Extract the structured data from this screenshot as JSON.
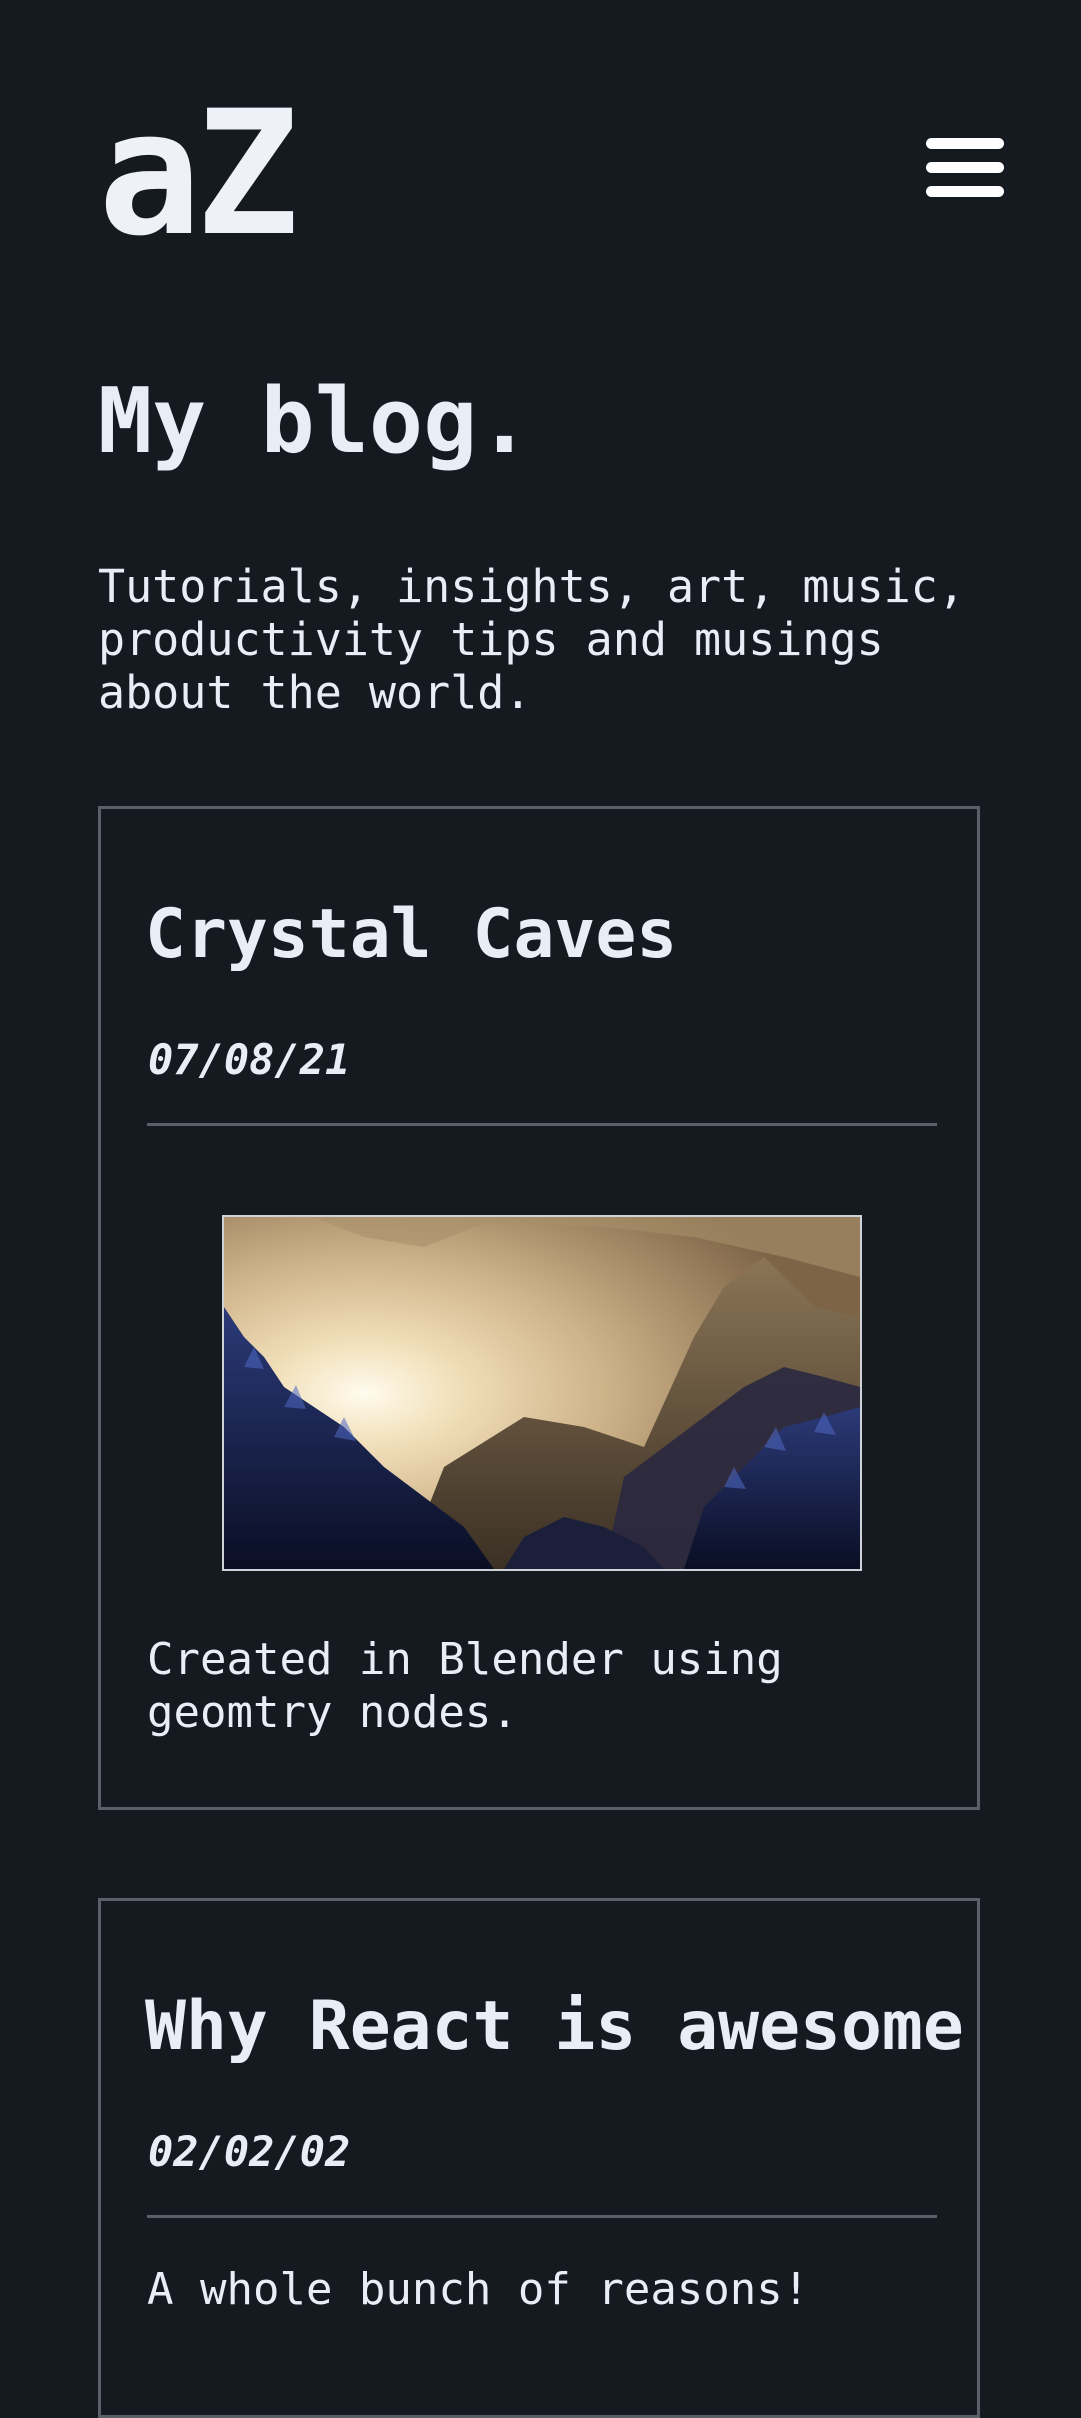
{
  "header": {
    "logo_text": "aZ",
    "menu_icon": "hamburger-menu-icon"
  },
  "hero": {
    "title": "My blog.",
    "intro": "Tutorials, insights, art, music, productivity tips and musings about the world."
  },
  "posts": [
    {
      "title": "Crystal Caves",
      "date": "07/08/21",
      "image": "crystal-cave-render",
      "excerpt": "Created in Blender using geomtry nodes."
    },
    {
      "title": "Why React is awesome",
      "date": "02/02/02",
      "excerpt": "A whole bunch of reasons!"
    }
  ],
  "colors": {
    "background": "#151a21",
    "text": "#e9eef6",
    "border": "#5b6068"
  }
}
